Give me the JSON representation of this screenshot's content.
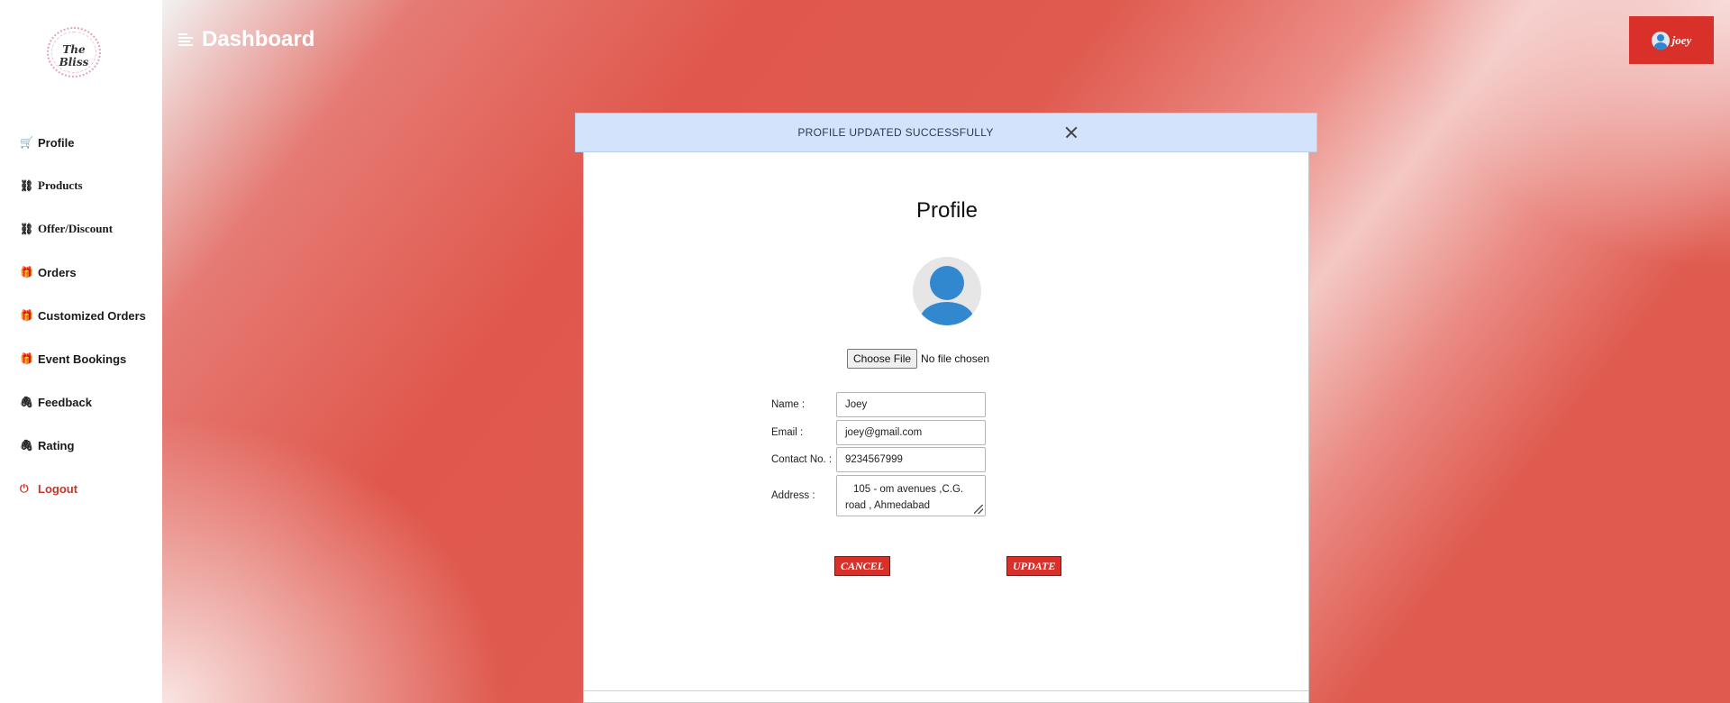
{
  "brand": {
    "logo_text": "The Bliss"
  },
  "sidebar": {
    "items": [
      {
        "label": "Profile",
        "icon": "shopping-cart-icon"
      },
      {
        "label": "Products",
        "icon": "sitemap-icon"
      },
      {
        "label": "Offer/Discount",
        "icon": "sitemap-icon"
      },
      {
        "label": "Orders",
        "icon": "gift-icon"
      },
      {
        "label": "Customized Orders",
        "icon": "gift-icon"
      },
      {
        "label": "Event Bookings",
        "icon": "gift-icon"
      },
      {
        "label": "Feedback",
        "icon": "paperclip-icon"
      },
      {
        "label": "Rating",
        "icon": "paperclip-icon"
      },
      {
        "label": "Logout",
        "icon": "power-icon"
      }
    ]
  },
  "header": {
    "title": "Dashboard",
    "user_name": "joey"
  },
  "alert": {
    "message": "PROFILE UPDATED SUCCESSFULLY"
  },
  "profile": {
    "title": "Profile",
    "file_button": "Choose File",
    "file_status": "No file chosen",
    "fields": {
      "name": {
        "label": "Name :",
        "value": "Joey"
      },
      "email": {
        "label": "Email :",
        "value": "joey@gmail.com"
      },
      "contact": {
        "label": "Contact No. :",
        "value": "9234567999"
      },
      "address": {
        "label": "Address :",
        "value": "105 - om avenues ,C.G. road , Ahmedabad"
      }
    },
    "cancel_label": "CANCEL",
    "update_label": "UPDATE"
  },
  "colors": {
    "accent": "#d9312a",
    "alert_bg": "#d3e3fb",
    "avatar_blue": "#3288cf"
  }
}
